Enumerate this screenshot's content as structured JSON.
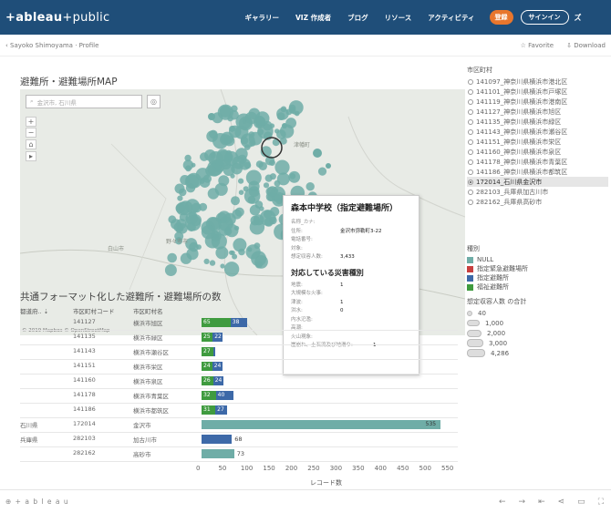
{
  "header": {
    "logo_main": "+ableau",
    "logo_suffix": "+public",
    "nav": [
      "ギャラリー",
      "VIZ 作成者",
      "ブログ",
      "リソース",
      "アクティビティ"
    ],
    "register_label": "登録",
    "signin_label": "サインイン",
    "more_label": "ズ"
  },
  "subbar": {
    "breadcrumb": "Sayoko Shimoyama · Profile",
    "favorite_label": "Favorite",
    "download_label": "Download"
  },
  "map": {
    "title": "避難所・避難場所MAP",
    "search_placeholder": "金沢市, 石川県",
    "credit": "© 2019 Mapbox © OpenStreetMap",
    "city_labels": [
      "白山市",
      "野々市市",
      "津幡町"
    ]
  },
  "tooltip": {
    "title": "森本中学校（指定避難場所）",
    "fields": [
      {
        "key": "名称_カナ:",
        "value": ""
      },
      {
        "key": "住所:",
        "value": "金沢市弥勒町3-22"
      },
      {
        "key": "電話番号:",
        "value": ""
      },
      {
        "key": "対象:",
        "value": ""
      },
      {
        "key": "想定収容人数:",
        "value": "3,433"
      }
    ],
    "section_title": "対応している災害種別",
    "hazards": [
      {
        "key": "地震:",
        "value": "1"
      },
      {
        "key": "大規模な火事:",
        "value": ""
      },
      {
        "key": "津波:",
        "value": "1"
      },
      {
        "key": "洪水:",
        "value": "0"
      },
      {
        "key": "内水氾濫:",
        "value": ""
      },
      {
        "key": "高潮:",
        "value": ""
      },
      {
        "key": "火山現象:",
        "value": ""
      },
      {
        "key": "崖崩れ、土石流及び地滑り:",
        "value": "1"
      }
    ]
  },
  "bar_section": {
    "title": "共通フォーマット化した避難所・避難場所の数",
    "col_prefecture": "都道府..",
    "col_code": "市区町村コード",
    "col_name": "市区町村名",
    "axis_title": "レコード数",
    "colors": {
      "teal": "#6fada7",
      "green": "#3f9b3f",
      "blue": "#3d69a8",
      "red": "#c84040"
    }
  },
  "chart_data": {
    "type": "bar",
    "orientation": "horizontal",
    "stacked": true,
    "rows": [
      {
        "prefecture": "",
        "code": "141127",
        "name": "横浜市旭区",
        "segments": [
          {
            "series": "指定避難所",
            "value": 65
          },
          {
            "series": "指定緊急避難場所",
            "value": 38
          }
        ]
      },
      {
        "prefecture": "",
        "code": "141135",
        "name": "横浜市緑区",
        "segments": [
          {
            "series": "指定避難所",
            "value": 25
          },
          {
            "series": "指定緊急避難場所",
            "value": 22
          }
        ]
      },
      {
        "prefecture": "",
        "code": "141143",
        "name": "横浜市瀬谷区",
        "segments": [
          {
            "series": "指定避難所",
            "value": 27
          },
          {
            "series": "指定緊急避難場所",
            "value": 3
          }
        ]
      },
      {
        "prefecture": "",
        "code": "141151",
        "name": "横浜市栄区",
        "segments": [
          {
            "series": "指定避難所",
            "value": 24
          },
          {
            "series": "指定緊急避難場所",
            "value": 24
          }
        ]
      },
      {
        "prefecture": "",
        "code": "141160",
        "name": "横浜市泉区",
        "segments": [
          {
            "series": "指定避難所",
            "value": 26
          },
          {
            "series": "指定緊急避難場所",
            "value": 24
          }
        ]
      },
      {
        "prefecture": "",
        "code": "141178",
        "name": "横浜市青葉区",
        "segments": [
          {
            "series": "指定避難所",
            "value": 32
          },
          {
            "series": "指定緊急避難場所",
            "value": 40
          }
        ]
      },
      {
        "prefecture": "",
        "code": "141186",
        "name": "横浜市都筑区",
        "segments": [
          {
            "series": "指定避難所",
            "value": 31
          },
          {
            "series": "指定緊急避難場所",
            "value": 27
          }
        ]
      },
      {
        "prefecture": "石川県",
        "code": "172014",
        "name": "金沢市",
        "segments": [
          {
            "series": "NULL",
            "value": 535
          }
        ]
      },
      {
        "prefecture": "兵庫県",
        "code": "282103",
        "name": "加古川市",
        "segments": [
          {
            "series": "指定緊急避難場所",
            "value": 68
          }
        ]
      },
      {
        "prefecture": "",
        "code": "282162",
        "name": "高砂市",
        "segments": [
          {
            "series": "NULL",
            "value": 73
          }
        ]
      }
    ],
    "xlim": [
      0,
      550
    ],
    "x_ticks": [
      0,
      50,
      100,
      150,
      200,
      250,
      300,
      350,
      400,
      450,
      500,
      550
    ],
    "xlabel": "レコード数"
  },
  "sidebar": {
    "filter_title": "市区町村",
    "municipalities": [
      {
        "label": "141097_神奈川県横浜市港北区",
        "selected": false
      },
      {
        "label": "141101_神奈川県横浜市戸塚区",
        "selected": false
      },
      {
        "label": "141119_神奈川県横浜市港南区",
        "selected": false
      },
      {
        "label": "141127_神奈川県横浜市旭区",
        "selected": false
      },
      {
        "label": "141135_神奈川県横浜市緑区",
        "selected": false
      },
      {
        "label": "141143_神奈川県横浜市瀬谷区",
        "selected": false
      },
      {
        "label": "141151_神奈川県横浜市栄区",
        "selected": false
      },
      {
        "label": "141160_神奈川県横浜市泉区",
        "selected": false
      },
      {
        "label": "141178_神奈川県横浜市青葉区",
        "selected": false
      },
      {
        "label": "141186_神奈川県横浜市都筑区",
        "selected": false
      },
      {
        "label": "172014_石川県金沢市",
        "selected": true
      },
      {
        "label": "282103_兵庫県加古川市",
        "selected": false
      },
      {
        "label": "282162_兵庫県高砂市",
        "selected": false
      }
    ],
    "type_legend_title": "種別",
    "type_legend": [
      {
        "label": "NULL",
        "color": "#6fada7"
      },
      {
        "label": "指定緊急避難場所",
        "color": "#c84040"
      },
      {
        "label": "指定避難所",
        "color": "#3d69a8"
      },
      {
        "label": "福祉避難所",
        "color": "#3f9b3f"
      }
    ],
    "size_legend_title": "想定収容人数 の合計",
    "size_legend": [
      "40",
      "1,000",
      "2,000",
      "3,000",
      "4,286"
    ]
  },
  "footer": {
    "brand": "⊕ + a b l e a u"
  }
}
